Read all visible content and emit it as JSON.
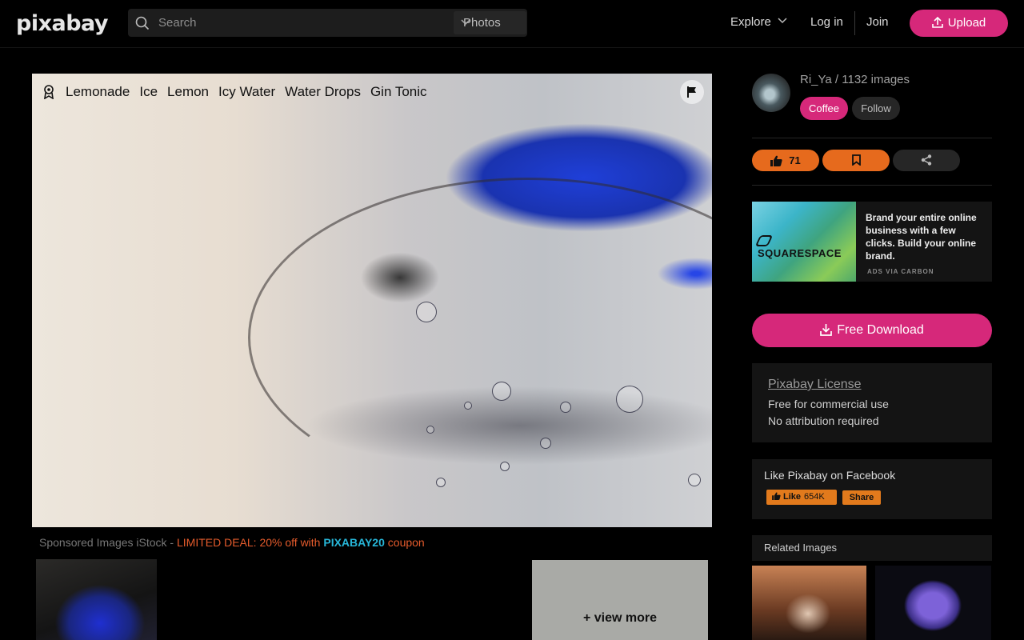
{
  "header": {
    "logo": "pixabay",
    "search_placeholder": "Search",
    "search_type": "Photos",
    "nav": {
      "explore": "Explore",
      "login": "Log in",
      "join": "Join",
      "upload": "Upload"
    }
  },
  "photo": {
    "tags": [
      "Lemonade",
      "Ice",
      "Lemon",
      "Icy Water",
      "Water Drops",
      "Gin Tonic"
    ]
  },
  "sponsored": {
    "prefix": "Sponsored Images iStock - ",
    "deal": "LIMITED DEAL: 20% off with ",
    "code": "PIXABAY20",
    "suffix": " coupon",
    "view_more": "+ view more"
  },
  "author": {
    "name_line": "Ri_Ya / 1132 images",
    "coffee": "Coffee",
    "follow": "Follow"
  },
  "actions": {
    "likes": "71"
  },
  "ad": {
    "brand": "SQUARESPACE",
    "text": "Brand your entire online business with a few clicks. Build your online brand.",
    "via": "ADS VIA CARBON"
  },
  "download": {
    "label": "Free Download"
  },
  "license": {
    "title": "Pixabay License",
    "line1": "Free for commercial use",
    "line2": "No attribution required"
  },
  "facebook": {
    "title": "Like Pixabay on Facebook",
    "like": "Like",
    "count": "654K",
    "share": "Share"
  },
  "related": {
    "title": "Related Images"
  },
  "colors": {
    "accent": "#d6287a",
    "orange": "#e66a1d",
    "background": "#000000"
  }
}
